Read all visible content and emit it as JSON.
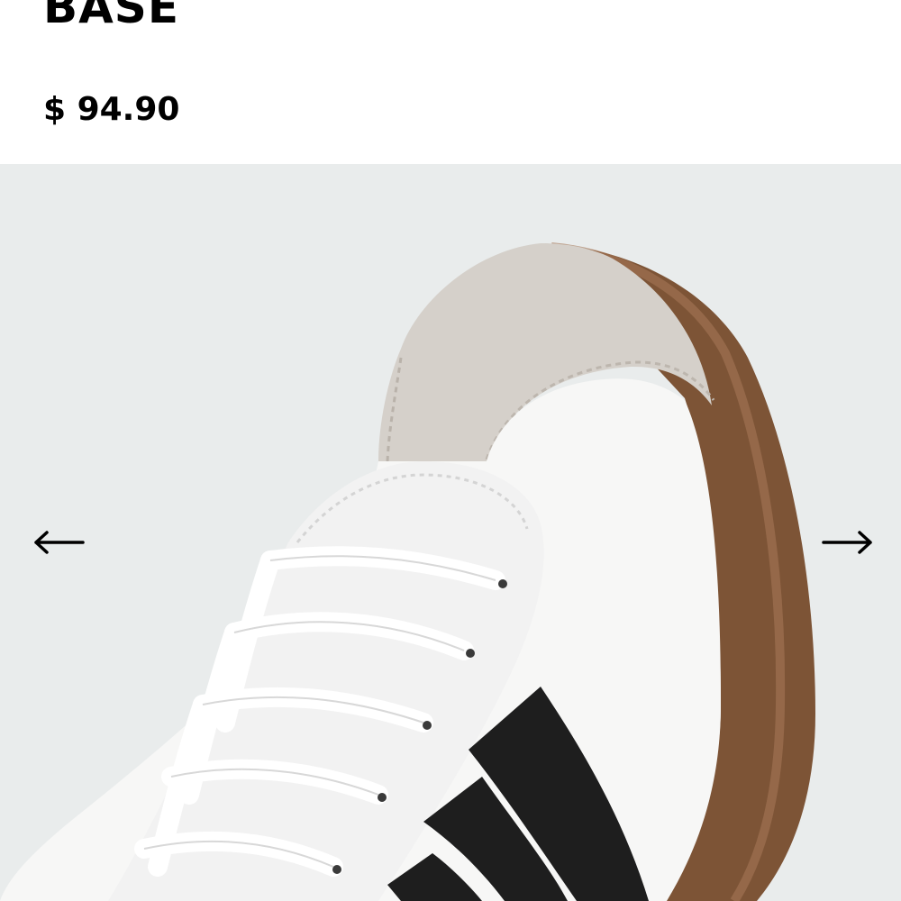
{
  "product": {
    "title": "BASE",
    "price": "$ 94.90"
  },
  "gallery": {
    "background_color": "#e9ecec",
    "prev_icon": "arrow-left-icon",
    "next_icon": "arrow-right-icon"
  }
}
